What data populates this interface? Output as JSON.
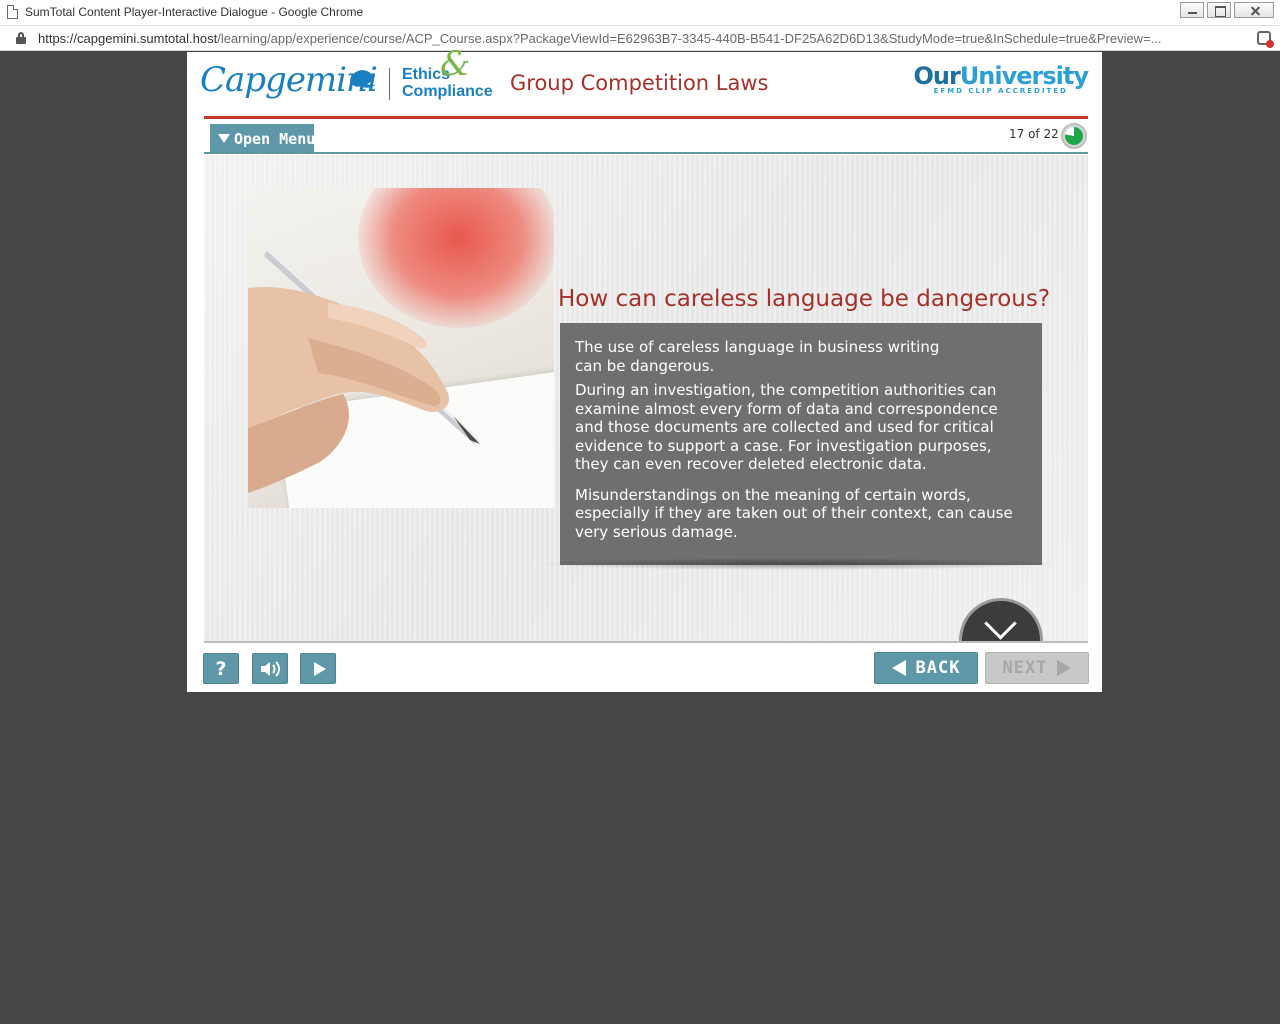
{
  "window": {
    "title": "SumTotal Content Player-Interactive Dialogue - Google Chrome"
  },
  "address_bar": {
    "url_host": "https://capgemini.sumtotal.host",
    "url_path": "/learning/app/experience/course/ACP_Course.aspx?PackageViewId=E62963B7-3345-440B-B541-DF25A62D6D13&StudyMode=true&InSchedule=true&Preview=..."
  },
  "header": {
    "brand_logo": "Capgemini",
    "ethics_line1": "Ethics",
    "ethics_amp": "&",
    "ethics_line2": "Compliance",
    "course_title": "Group Competition Laws",
    "university_name_1": "Our",
    "university_name_2": "University",
    "university_sub": "EFMD CLIP ACCREDITED"
  },
  "menu": {
    "label": "Open Menu"
  },
  "progress": {
    "label": "17 of 22",
    "current": 17,
    "total": 22
  },
  "slide": {
    "heading": "How can careless language be dangerous?",
    "paragraphs": [
      "The use of careless language in business writing can be dangerous.",
      "During an investigation, the competition authorities can examine almost every form of data and correspondence and those documents are collected and used for critical evidence to support a case. For investigation purposes, they can even recover deleted electronic data.",
      "Misunderstandings on the meaning of certain words, especially if they are taken out of their context, can cause very serious damage."
    ]
  },
  "controls": {
    "help_label": "?",
    "back_label": "BACK",
    "next_label": "NEXT"
  },
  "colors": {
    "accent_teal": "#5e97a8",
    "title_red": "#a4312b",
    "brand_blue": "#1a7fbf",
    "ethics_green": "#7ab648"
  }
}
